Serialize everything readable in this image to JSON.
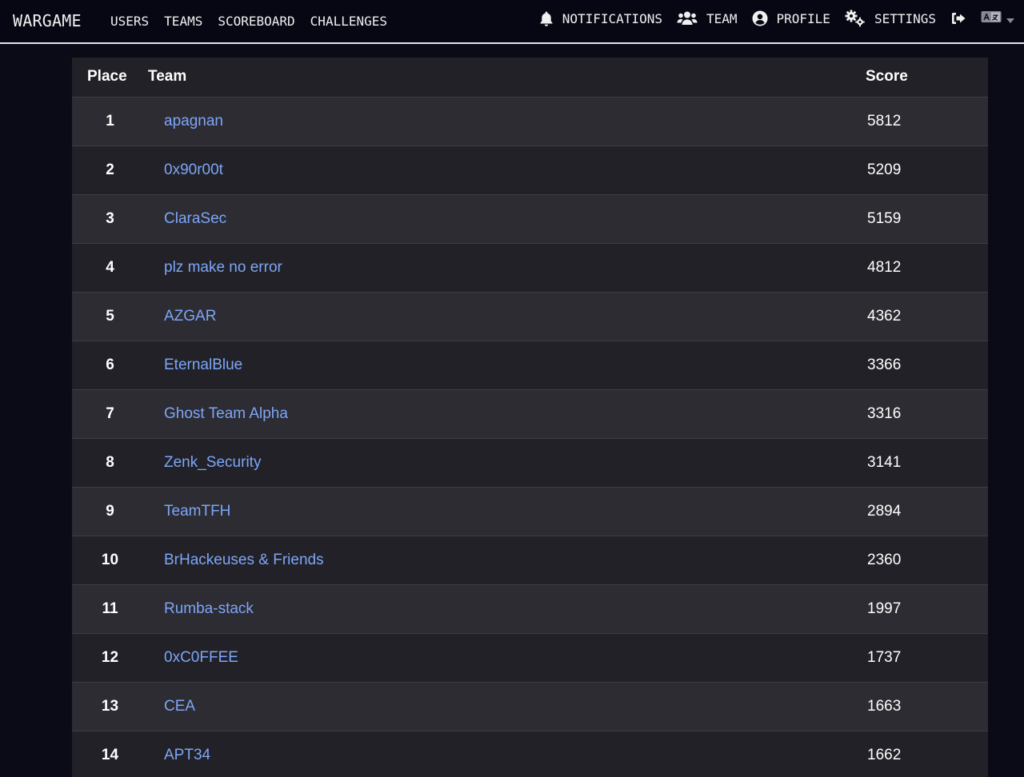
{
  "nav": {
    "brand": "WARGAME",
    "links": [
      "USERS",
      "TEAMS",
      "SCOREBOARD",
      "CHALLENGES"
    ],
    "notifications": "NOTIFICATIONS",
    "team": "TEAM",
    "profile": "PROFILE",
    "settings": "SETTINGS"
  },
  "table": {
    "headers": {
      "place": "Place",
      "team": "Team",
      "score": "Score"
    },
    "rows": [
      {
        "place": "1",
        "team": "apagnan",
        "score": "5812"
      },
      {
        "place": "2",
        "team": "0x90r00t",
        "score": "5209"
      },
      {
        "place": "3",
        "team": "ClaraSec",
        "score": "5159"
      },
      {
        "place": "4",
        "team": "plz make no error",
        "score": "4812"
      },
      {
        "place": "5",
        "team": "AZGAR",
        "score": "4362"
      },
      {
        "place": "6",
        "team": "EternalBlue",
        "score": "3366"
      },
      {
        "place": "7",
        "team": "Ghost Team Alpha",
        "score": "3316"
      },
      {
        "place": "8",
        "team": "Zenk_Security",
        "score": "3141"
      },
      {
        "place": "9",
        "team": "TeamTFH",
        "score": "2894"
      },
      {
        "place": "10",
        "team": "BrHackeuses & Friends",
        "score": "2360"
      },
      {
        "place": "11",
        "team": "Rumba-stack",
        "score": "1997"
      },
      {
        "place": "12",
        "team": "0xC0FFEE",
        "score": "1737"
      },
      {
        "place": "13",
        "team": "CEA",
        "score": "1663"
      },
      {
        "place": "14",
        "team": "APT34",
        "score": "1662"
      }
    ]
  }
}
